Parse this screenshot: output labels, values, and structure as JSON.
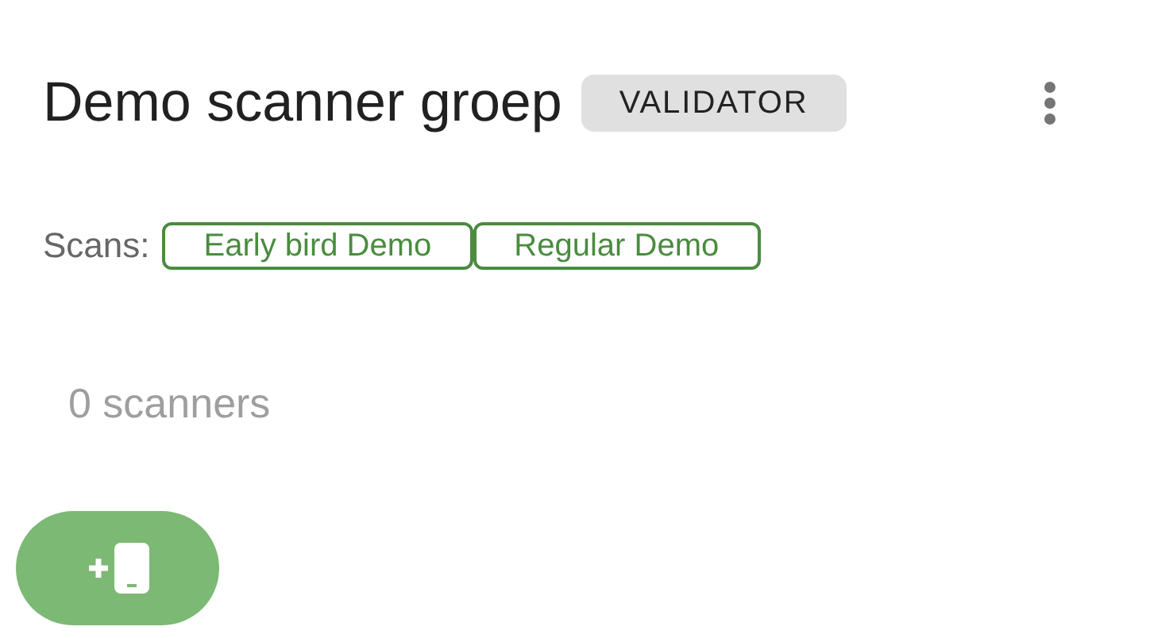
{
  "group": {
    "title": "Demo scanner groep",
    "role_badge": "VALIDATOR"
  },
  "scans": {
    "label": "Scans:",
    "items": [
      {
        "label": "Early bird Demo"
      },
      {
        "label": "Regular Demo"
      }
    ]
  },
  "scanner_count": "0 scanners"
}
